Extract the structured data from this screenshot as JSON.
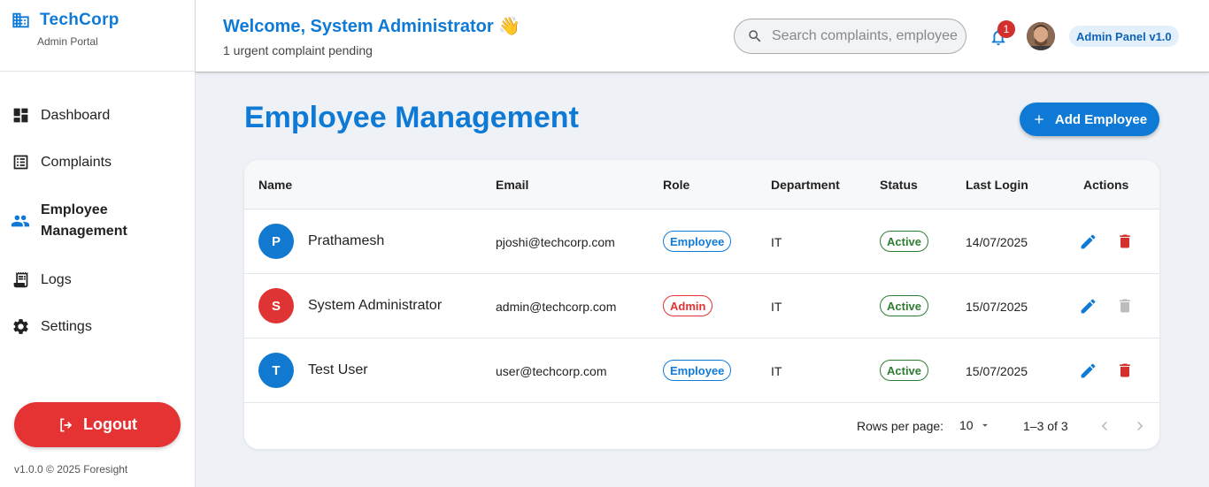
{
  "brand": {
    "name": "TechCorp",
    "subtitle": "Admin Portal"
  },
  "sidebar": {
    "items": [
      {
        "label": "Dashboard",
        "icon": "dashboard-icon"
      },
      {
        "label": "Complaints",
        "icon": "list-icon"
      },
      {
        "label": "Employee Management",
        "icon": "people-icon",
        "active": true
      },
      {
        "label": "Logs",
        "icon": "receipt-icon"
      },
      {
        "label": "Settings",
        "icon": "gear-icon"
      }
    ],
    "logout_label": "Logout",
    "footer": "v1.0.0 © 2025 Foresight"
  },
  "header": {
    "welcome": "Welcome, System Administrator 👋",
    "subtitle": "1 urgent complaint pending",
    "search_placeholder": "Search complaints, employees...",
    "notification_count": "1",
    "panel_label": "Admin Panel v1.0"
  },
  "main": {
    "title": "Employee Management",
    "add_button": "Add Employee"
  },
  "table": {
    "columns": [
      "Name",
      "Email",
      "Role",
      "Department",
      "Status",
      "Last Login",
      "Actions"
    ],
    "rows": [
      {
        "initial": "P",
        "avatar_color": "#1279d0",
        "name": "Prathamesh",
        "email": "pjoshi@techcorp.com",
        "role": "Employee",
        "department": "IT",
        "status": "Active",
        "last_login": "14/07/2025",
        "delete_enabled": true
      },
      {
        "initial": "S",
        "avatar_color": "#e03333",
        "name": "System Administrator",
        "email": "admin@techcorp.com",
        "role": "Admin",
        "department": "IT",
        "status": "Active",
        "last_login": "15/07/2025",
        "delete_enabled": false
      },
      {
        "initial": "T",
        "avatar_color": "#1279d0",
        "name": "Test User",
        "email": "user@techcorp.com",
        "role": "Employee",
        "department": "IT",
        "status": "Active",
        "last_login": "15/07/2025",
        "delete_enabled": true
      }
    ]
  },
  "pagination": {
    "rows_per_page_label": "Rows per page:",
    "rows_per_page": "10",
    "range": "1–3 of 3"
  },
  "colors": {
    "primary": "#0f7ad6",
    "danger": "#e53232",
    "success": "#2e7d32",
    "disabled": "#bdbdbd"
  }
}
